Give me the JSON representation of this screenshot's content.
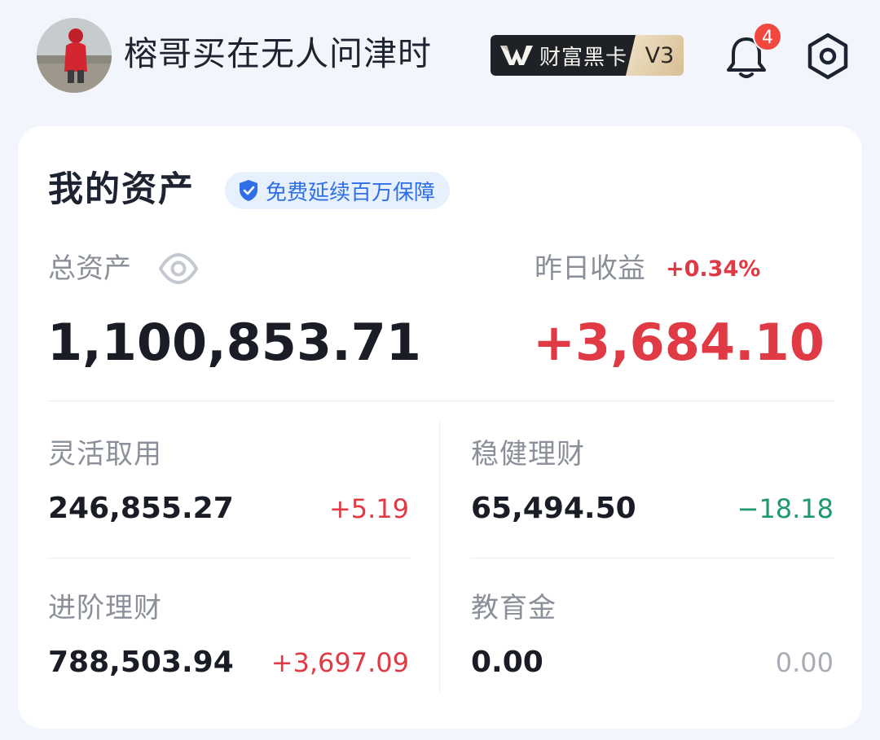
{
  "header": {
    "username": "榕哥买在无人问津时",
    "vip": {
      "name": "财富黑卡",
      "level": "V3"
    },
    "notification_count": "4",
    "icons": {
      "bell": "bell-icon",
      "settings": "settings-icon"
    }
  },
  "assets": {
    "title": "我的资产",
    "guarantee": "免费延续百万保障",
    "total_label": "总资产",
    "total_value": "1,100,853.71",
    "yesterday_label": "昨日收益",
    "yesterday_rate": "+0.34%",
    "yesterday_value": "+3,684.10",
    "items": [
      {
        "label": "灵活取用",
        "value": "246,855.27",
        "change": "+5.19"
      },
      {
        "label": "稳健理财",
        "value": "65,494.50",
        "change": "−18.18"
      },
      {
        "label": "进阶理财",
        "value": "788,503.94",
        "change": "+3,697.09"
      },
      {
        "label": "教育金",
        "value": "0.00",
        "change": "0.00"
      }
    ]
  },
  "colors": {
    "gain": "#e03a45",
    "loss": "#1f9a6d",
    "neutral": "#a8adb5",
    "accent": "#2f6ee6"
  }
}
